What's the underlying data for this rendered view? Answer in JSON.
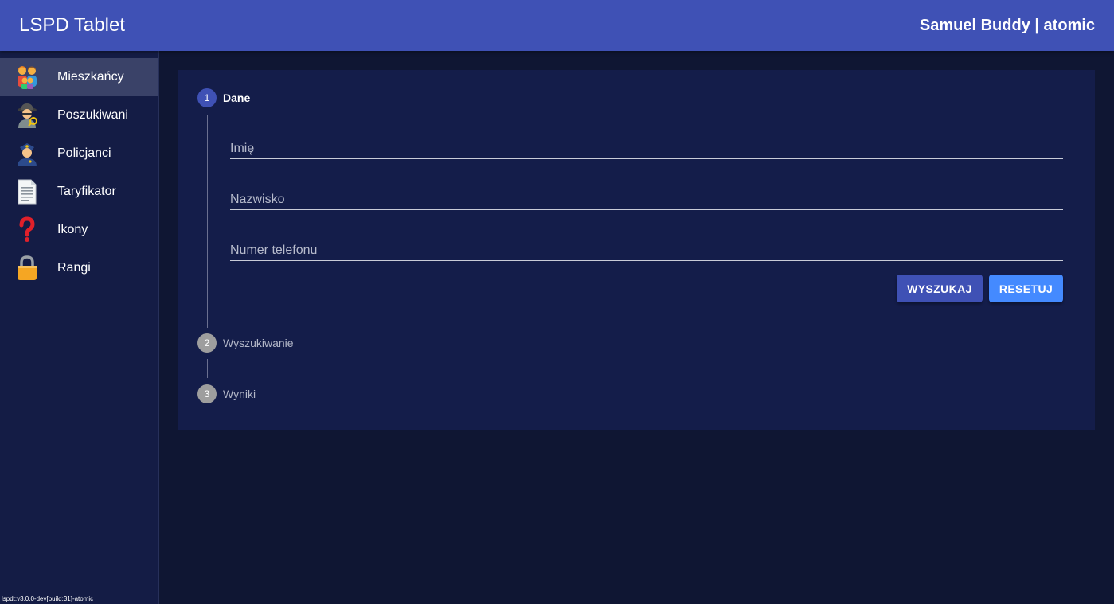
{
  "appbar": {
    "title": "LSPD Tablet",
    "user": "Samuel Buddy | atomic"
  },
  "sidebar": {
    "items": [
      {
        "label": "Mieszkańcy",
        "icon": "family-icon",
        "active": true
      },
      {
        "label": "Poszukiwani",
        "icon": "detective-icon",
        "active": false
      },
      {
        "label": "Policjanci",
        "icon": "police-officer-icon",
        "active": false
      },
      {
        "label": "Taryfikator",
        "icon": "document-icon",
        "active": false
      },
      {
        "label": "Ikony",
        "icon": "question-mark-icon",
        "active": false
      },
      {
        "label": "Rangi",
        "icon": "lock-icon",
        "active": false
      }
    ],
    "version": "lspdt:v3.0.0-dev[build:31]-atomic"
  },
  "stepper": {
    "steps": [
      {
        "number": "1",
        "label": "Dane",
        "active": true
      },
      {
        "number": "2",
        "label": "Wyszukiwanie",
        "active": false
      },
      {
        "number": "3",
        "label": "Wyniki",
        "active": false
      }
    ]
  },
  "form": {
    "first_name": {
      "placeholder": "Imię",
      "value": ""
    },
    "last_name": {
      "placeholder": "Nazwisko",
      "value": ""
    },
    "phone": {
      "placeholder": "Numer telefonu",
      "value": ""
    },
    "search_label": "WYSZUKAJ",
    "reset_label": "RESETUJ"
  },
  "colors": {
    "appbar": "#3f51b5",
    "background": "#0f1633",
    "sidebar": "#141c45",
    "panel": "#141d4a",
    "primary_button": "#3f51b5",
    "secondary_button": "#448aff"
  }
}
